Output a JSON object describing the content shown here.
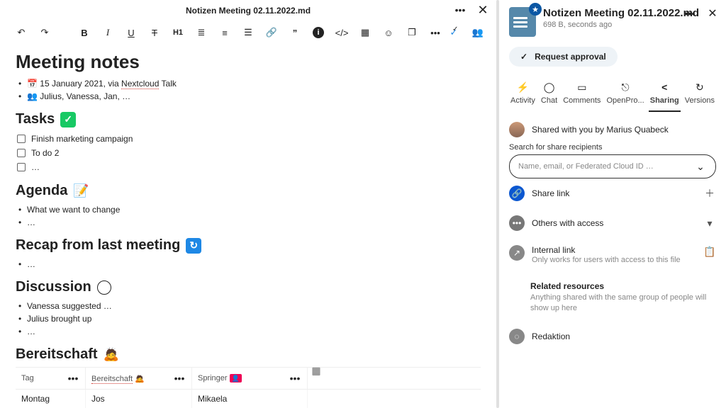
{
  "editor": {
    "header_title": "Notizen Meeting 02.11.2022.md",
    "doc": {
      "h1": "Meeting notes",
      "meta1_prefix": "15 January 2021, via ",
      "meta1_link": "Nextcloud",
      "meta1_suffix": " Talk",
      "meta2": "Julius, Vanessa, Jan, …",
      "tasks_h": "Tasks",
      "tasks": [
        "Finish marketing campaign",
        "To do 2",
        "…"
      ],
      "agenda_h": "Agenda",
      "agenda_items": [
        "What we want to change",
        "…"
      ],
      "recap_h": "Recap from last meeting",
      "recap_items": [
        "…"
      ],
      "discussion_h": "Discussion",
      "discussion_items": [
        "Vanessa suggested …",
        "Julius brought up",
        "…"
      ],
      "bereit_h": "Bereitschaft",
      "table_headers": [
        "Tag",
        "Bereitschaft",
        "Springer"
      ],
      "table_row": [
        "Montag",
        "Jos",
        "Mikaela"
      ]
    }
  },
  "panel": {
    "title": "Notizen Meeting 02.11.2022.md",
    "subtitle": "698 B, seconds ago",
    "request_approval": "Request approval",
    "tabs": [
      "Activity",
      "Chat",
      "Comments",
      "OpenPro...",
      "Sharing",
      "Versions"
    ],
    "active_tab": "Sharing",
    "shared_with": "Shared with you by Marius Quabeck",
    "search_label": "Search for share recipients",
    "search_placeholder": "Name, email, or Federated Cloud ID …",
    "share_link": "Share link",
    "others": "Others with access",
    "internal": "Internal link",
    "internal_sub": "Only works for users with access to this file",
    "related_h": "Related resources",
    "related_sub": "Anything shared with the same group of people will show up here",
    "redaktion": "Redaktion"
  }
}
